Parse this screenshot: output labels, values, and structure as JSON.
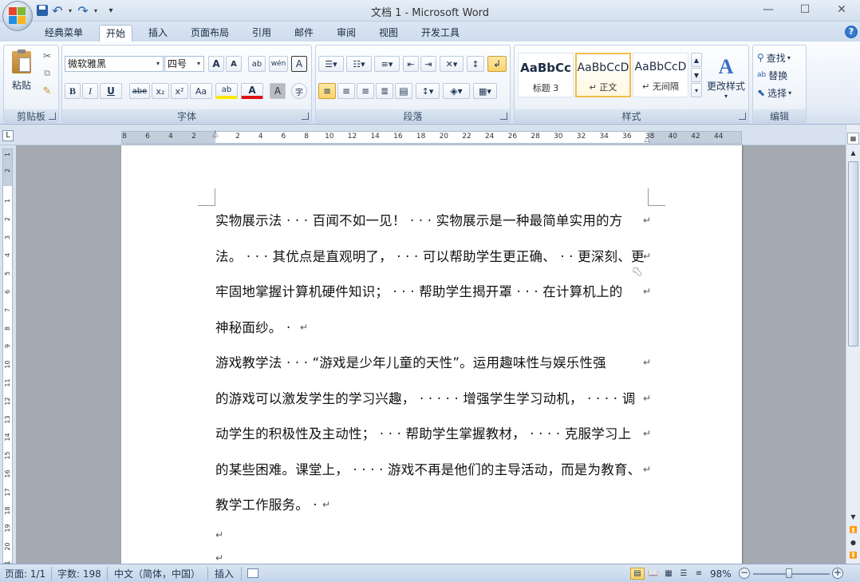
{
  "window": {
    "title": "文档 1 - Microsoft Word",
    "minimize": "—",
    "maximize": "☐",
    "close": "✕"
  },
  "qat": {
    "save": "💾",
    "undo": "↶",
    "redo": "↷",
    "customize": "▾"
  },
  "tabs": [
    "经典菜单",
    "开始",
    "插入",
    "页面布局",
    "引用",
    "邮件",
    "审阅",
    "视图",
    "开发工具"
  ],
  "active_tab": "开始",
  "help": "?",
  "ribbon": {
    "clipboard": {
      "label": "剪贴板",
      "paste": "粘贴"
    },
    "font": {
      "label": "字体",
      "font_name": "微软雅黑",
      "font_size": "四号",
      "grow": "A",
      "shrink": "A",
      "clear": "ab",
      "phonetic": "wén",
      "border": "A",
      "bold": "B",
      "italic": "I",
      "underline": "U",
      "strike": "abe",
      "subscript": "x₂",
      "superscript": "x²",
      "change_case": "Aa",
      "highlight": "ab",
      "font_color": "A",
      "char_shading": "A",
      "enclose": "字"
    },
    "paragraph": {
      "label": "段落"
    },
    "styles": {
      "label": "样式",
      "items": [
        {
          "sample": "AaBbCc",
          "name": "标题 3"
        },
        {
          "sample": "AaBbCcD",
          "name": "↵ 正文"
        },
        {
          "sample": "AaBbCcD",
          "name": "↵ 无间隔"
        }
      ],
      "change_styles": "更改样式"
    },
    "editing": {
      "label": "编辑",
      "find": "查找",
      "replace": "替换",
      "select": "选择"
    }
  },
  "ruler": {
    "h_numbers": [
      "8",
      "6",
      "4",
      "2",
      "2",
      "4",
      "6",
      "8",
      "10",
      "12",
      "14",
      "16",
      "18",
      "20",
      "22",
      "24",
      "26",
      "28",
      "30",
      "32",
      "34",
      "36",
      "38",
      "40",
      "42",
      "44"
    ],
    "v_numbers": [
      "2",
      "1",
      "1",
      "2",
      "3",
      "4",
      "5",
      "6",
      "7",
      "8",
      "9",
      "10",
      "11",
      "12",
      "13",
      "14",
      "15",
      "16",
      "17",
      "18",
      "19",
      "20",
      "21"
    ],
    "corner": "L"
  },
  "document": {
    "lines": [
      "实物展示法 · · · 百闻不如一见！ · · · 实物展示是一种最简单实用的方",
      "法。 · · · 其优点是直观明了， · · · 可以帮助学生更正确、 · · 更深刻、更",
      "牢固地掌握计算机硬件知识； · · · 帮助学生揭开罩 · · · 在计算机上的",
      "神秘面纱。 ·",
      "游戏教学法 · · · “游戏是少年儿童的天性”。运用趣味性与娱乐性强",
      "的游戏可以激发学生的学习兴趣， · · · · · 增强学生学习动机， · · · · 调",
      "动学生的积极性及主动性； · · · 帮助学生掌握教材， · · · · 克服学习上",
      "的某些困难。课堂上， · · · · 游戏不再是他们的主导活动，而是为教育、",
      "教学工作服务。 ·"
    ],
    "para_mark": "↵"
  },
  "status": {
    "page": "页面: 1/1",
    "words": "字数: 198",
    "language": "中文（简体，中国）",
    "insert": "插入",
    "zoom": "98%"
  },
  "colors": {
    "accent": "#2a5fa8",
    "highlight": "#ffe800",
    "font_color": "#e01010"
  }
}
